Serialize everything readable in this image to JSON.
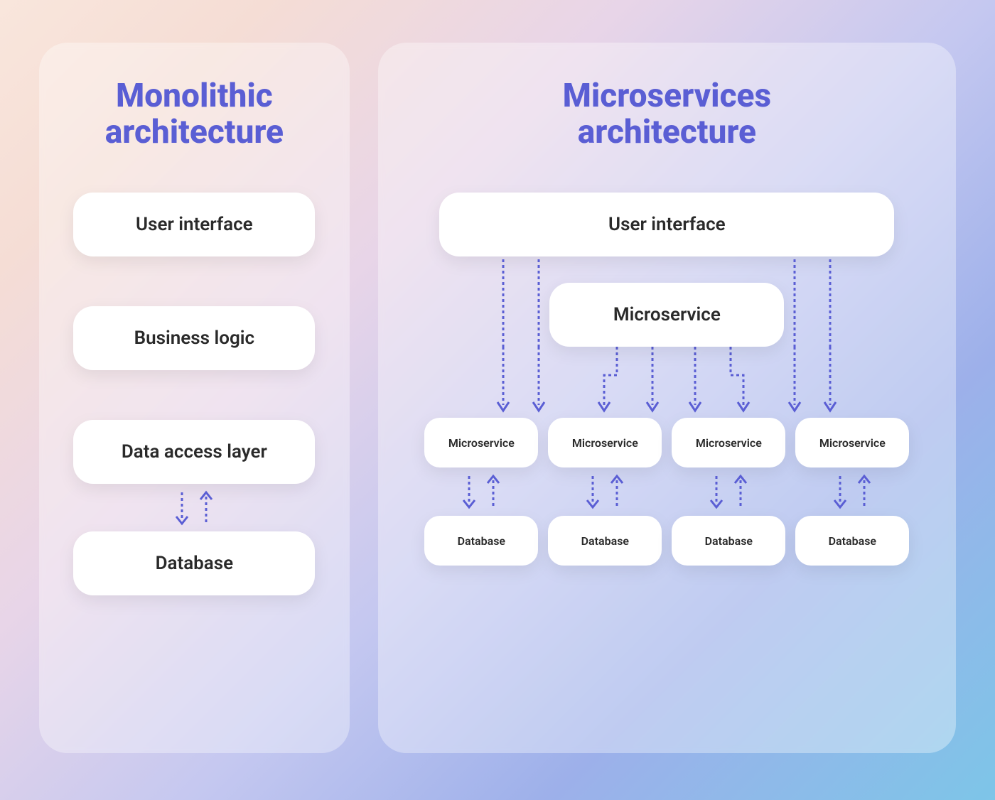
{
  "monolithic": {
    "title": "Monolithic\narchitecture",
    "boxes": {
      "ui": "User interface",
      "business": "Business logic",
      "data_access": "Data access layer",
      "database": "Database"
    }
  },
  "microservices": {
    "title": "Microservices\narchitecture",
    "boxes": {
      "ui": "User interface",
      "middle": "Microservice",
      "services": [
        "Microservice",
        "Microservice",
        "Microservice",
        "Microservice"
      ],
      "databases": [
        "Database",
        "Database",
        "Database",
        "Database"
      ]
    }
  },
  "colors": {
    "arrow": "#5a5ed4",
    "title": "#5a5ed4"
  }
}
